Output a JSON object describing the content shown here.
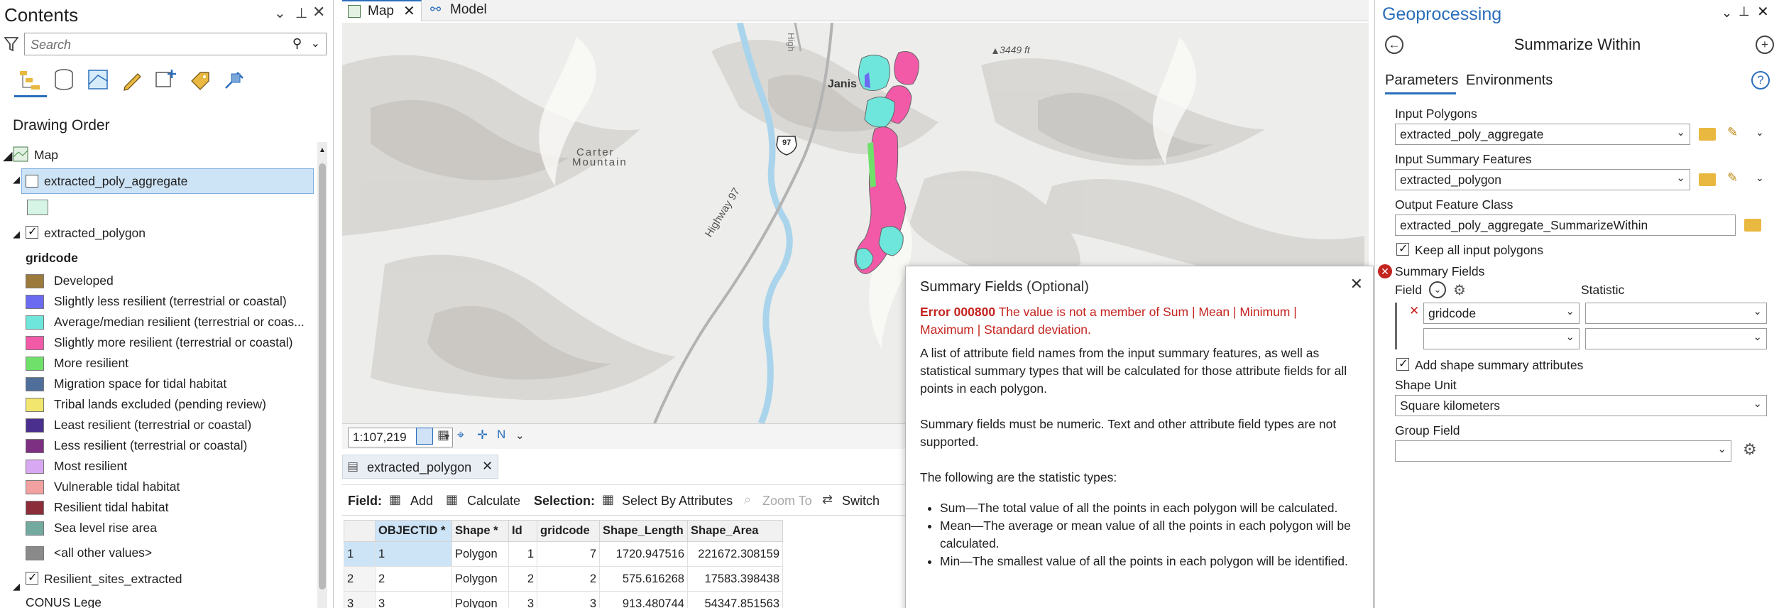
{
  "contents": {
    "title": "Contents",
    "search_placeholder": "Search",
    "drawing_order": "Drawing Order",
    "map_node": "Map",
    "layer1": "extracted_poly_aggregate",
    "layer2": "extracted_polygon",
    "field_heading": "gridcode",
    "legend": [
      {
        "label": "Developed",
        "color": "#9b7a3c"
      },
      {
        "label": "Slightly less resilient (terrestrial or coastal)",
        "color": "#6b6bf2"
      },
      {
        "label": "Average/median resilient (terrestrial or coas...",
        "color": "#6ee6dc"
      },
      {
        "label": "Slightly more resilient (terrestrial or coastal)",
        "color": "#f25aa8"
      },
      {
        "label": "More resilient",
        "color": "#6fe06a"
      },
      {
        "label": "Migration space for tidal habitat",
        "color": "#4f6e9a"
      },
      {
        "label": "Tribal lands excluded (pending review)",
        "color": "#f2e66e"
      },
      {
        "label": "Least resilient (terrestrial or coastal)",
        "color": "#4a2f8f"
      },
      {
        "label": "Less resilient (terrestrial or coastal)",
        "color": "#7d2f82"
      },
      {
        "label": "Most resilient",
        "color": "#d9a8f2"
      },
      {
        "label": "Vulnerable tidal habitat",
        "color": "#f2a0a0"
      },
      {
        "label": "Resilient tidal habitat",
        "color": "#8c2d3a"
      },
      {
        "label": "Sea level rise area",
        "color": "#72aaa0"
      },
      {
        "label": "<all other values>",
        "color": "#8a8a8a"
      }
    ],
    "layer3": "Resilient_sites_extracted",
    "layer4": "CONUS Lege"
  },
  "map": {
    "tab_map": "Map",
    "tab_model": "Model",
    "labels": {
      "janis": "Janis",
      "carter": "Carter",
      "mountain": "Mountain",
      "elevation": "3449 ft",
      "highway": "Highway 97",
      "shield": "97",
      "high": "High"
    },
    "scale": "1:107,219"
  },
  "table": {
    "tab": "extracted_polygon",
    "toolbar": {
      "field_label": "Field:",
      "add": "Add",
      "calculate": "Calculate",
      "selection_label": "Selection:",
      "select_by_attributes": "Select By Attributes",
      "zoom_to": "Zoom To",
      "switch": "Switch"
    },
    "columns": [
      "OBJECTID *",
      "Shape *",
      "Id",
      "gridcode",
      "Shape_Length",
      "Shape_Area"
    ],
    "rows": [
      {
        "n": "1",
        "cells": [
          "1",
          "Polygon",
          "1",
          "7",
          "1720.947516",
          "221672.308159"
        ]
      },
      {
        "n": "2",
        "cells": [
          "2",
          "Polygon",
          "2",
          "2",
          "575.616268",
          "17583.398438"
        ]
      },
      {
        "n": "3",
        "cells": [
          "3",
          "Polygon",
          "3",
          "3",
          "913.480744",
          "54347.851563"
        ]
      }
    ]
  },
  "tooltip": {
    "title": "Summary Fields",
    "optional": "(Optional)",
    "error_code": "Error 000800",
    "error_text": "The value is not a member of Sum | Mean | Minimum | Maximum | Standard deviation.",
    "p1": "A list of attribute field names from the input summary features, as well as statistical summary types that will be calculated for those attribute fields for all points in each polygon.",
    "p2": "Summary fields must be numeric. Text and other attribute field types are not supported.",
    "p3": "The following are the statistic types:",
    "bullets": [
      "Sum—The total value of all the points in each polygon will be calculated.",
      "Mean—The average or mean value of all the points in each polygon will be calculated.",
      "Min—The smallest value of all the points in each polygon will be identified."
    ]
  },
  "geo": {
    "title": "Geoprocessing",
    "tool_title": "Summarize Within",
    "tab_parameters": "Parameters",
    "tab_environments": "Environments",
    "input_polygons_label": "Input Polygons",
    "input_polygons_value": "extracted_poly_aggregate",
    "input_summary_label": "Input Summary Features",
    "input_summary_value": "extracted_polygon",
    "output_label": "Output Feature Class",
    "output_value": "extracted_poly_aggregate_SummarizeWithin",
    "keep_all_label": "Keep all input polygons",
    "summary_fields_label": "Summary Fields",
    "field_col": "Field",
    "statistic_col": "Statistic",
    "field_value": "gridcode",
    "add_shape_label": "Add shape summary  attributes",
    "shape_unit_label": "Shape Unit",
    "shape_unit_value": "Square kilometers",
    "group_field_label": "Group Field",
    "accent": "#2a6ebb",
    "error_color": "#c4241f"
  }
}
